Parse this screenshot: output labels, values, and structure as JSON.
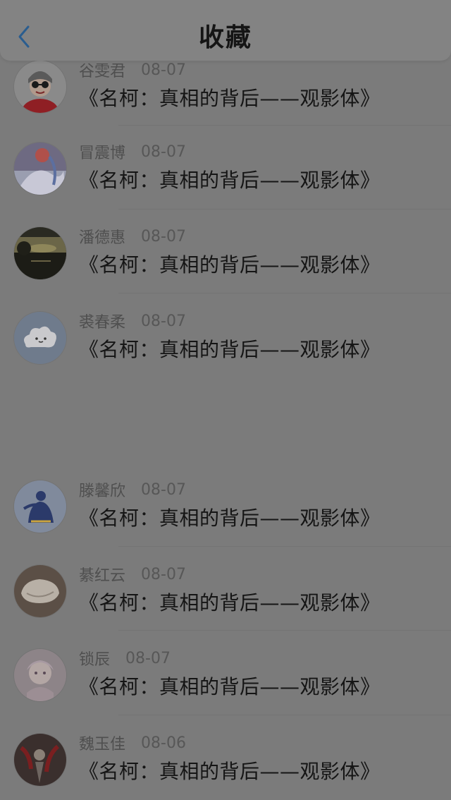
{
  "header": {
    "title": "收藏",
    "back_icon": "chevron-left-icon",
    "back_color": "#2a5d8f"
  },
  "items": [
    {
      "name": "谷雯君",
      "date": "08-07",
      "content": "《名柯：真相的背后——观影体》",
      "avatar": "avatar-red-glasses"
    },
    {
      "name": "冒震博",
      "date": "08-07",
      "content": "《名柯：真相的背后——观影体》",
      "avatar": "avatar-fantasy-moon"
    },
    {
      "name": "潘德惠",
      "date": "08-07",
      "content": "《名柯：真相的背后——观影体》",
      "avatar": "avatar-landscape-dusk"
    },
    {
      "name": "裘春柔",
      "date": "08-07",
      "content": "《名柯：真相的背后——观影体》",
      "avatar": "avatar-cloud-cartoon"
    },
    {
      "name": "滕馨欣",
      "date": "08-07",
      "content": "《名柯：真相的背后——观影体》",
      "avatar": "avatar-blue-dancer"
    },
    {
      "name": "綦红云",
      "date": "08-07",
      "content": "《名柯：真相的背后——观影体》",
      "avatar": "avatar-white-bowl"
    },
    {
      "name": "锁辰",
      "date": "08-07",
      "content": "《名柯：真相的背后——观影体》",
      "avatar": "avatar-anime-girl"
    },
    {
      "name": "魏玉佳",
      "date": "08-06",
      "content": "《名柯：真相的背后——观影体》",
      "avatar": "avatar-red-flowers"
    }
  ]
}
